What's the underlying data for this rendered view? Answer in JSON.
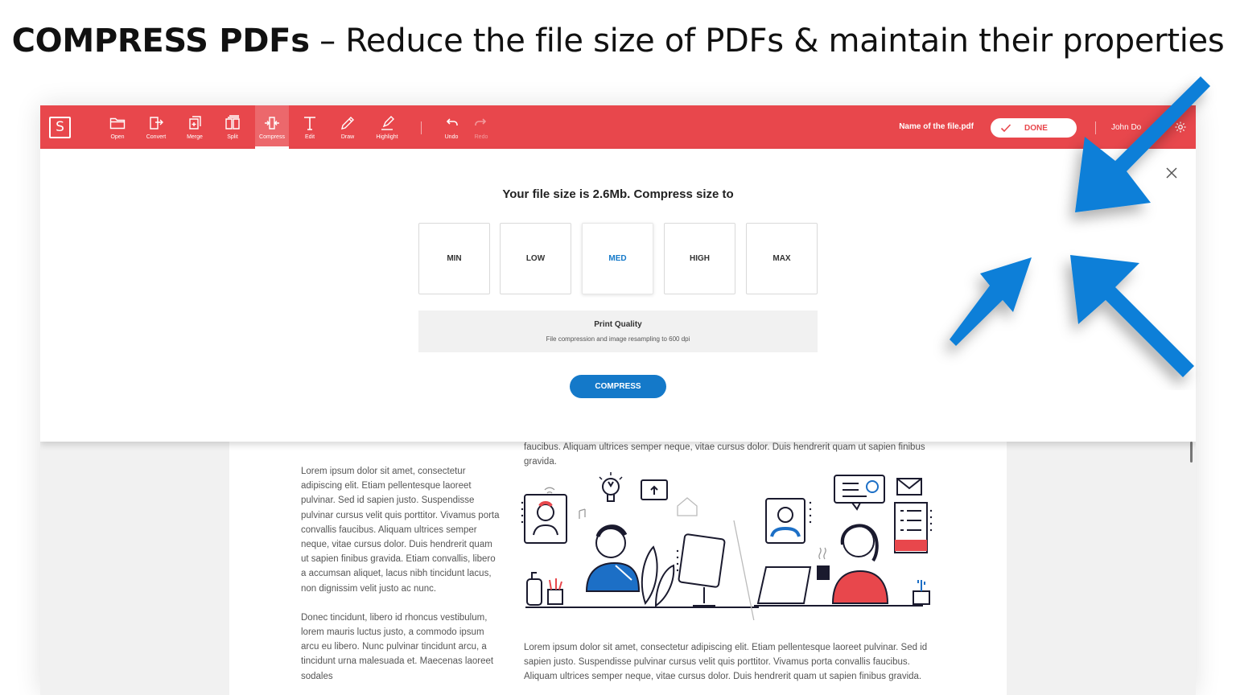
{
  "headline": {
    "bold": "COMPRESS PDFs",
    "rest": " – Reduce the file size of PDFs & maintain their properties"
  },
  "toolbar": {
    "logo": "S",
    "tools": [
      {
        "label": "Open",
        "icon": "folder-icon"
      },
      {
        "label": "Convert",
        "icon": "convert-icon"
      },
      {
        "label": "Merge",
        "icon": "merge-icon"
      },
      {
        "label": "Split",
        "icon": "split-icon"
      },
      {
        "label": "Compress",
        "icon": "compress-icon",
        "active": true
      },
      {
        "label": "Edit",
        "icon": "text-icon"
      },
      {
        "label": "Draw",
        "icon": "pencil-icon"
      },
      {
        "label": "Highlight",
        "icon": "highlighter-icon"
      },
      {
        "label": "Undo",
        "icon": "undo-icon"
      },
      {
        "label": "Redo",
        "icon": "redo-icon",
        "disabled": true
      }
    ],
    "filename": "Name of the file.pdf",
    "done_label": "DONE",
    "user": "John Do"
  },
  "compress": {
    "title": "Your file size is 2.6Mb. Compress size to",
    "options": [
      "MIN",
      "LOW",
      "MED",
      "HIGH",
      "MAX"
    ],
    "selected": "MED",
    "quality_title": "Print Quality",
    "quality_desc": "File compression and image resampling to 600 dpi",
    "button": "COMPRESS"
  },
  "document": {
    "col1_p1": "Lorem ipsum dolor sit amet, consectetur adipiscing elit. Etiam pellentesque laoreet pulvinar. Sed id sapien justo. Suspendisse pulvinar cursus velit quis porttitor. Vivamus porta convallis faucibus. Aliquam ultrices semper neque, vitae cursus dolor. Duis hendrerit quam ut sapien finibus gravida. Etiam convallis, libero a accumsan aliquet, lacus nibh tincidunt lacus, non dignissim velit justo ac nunc.",
    "col1_p2": "Donec tincidunt, libero id rhoncus vestibulum, lorem mauris luctus justo, a commodo ipsum arcu eu libero. Nunc pulvinar tincidunt arcu, a tincidunt urna malesuada et. Maecenas laoreet sodales",
    "col2_top": "faucibus. Aliquam ultrices semper neque, vitae cursus dolor. Duis hendrerit quam ut sapien finibus gravida.",
    "col2_bottom": "Lorem ipsum dolor sit amet, consectetur adipiscing elit. Etiam pellentesque laoreet pulvinar. Sed id sapien justo. Suspendisse pulvinar cursus velit quis porttitor. Vivamus porta convallis faucibus. Aliquam ultrices semper neque, vitae cursus dolor. Duis hendrerit quam ut sapien finibus gravida."
  },
  "colors": {
    "brand_red": "#e8474c",
    "accent_blue": "#1479c9",
    "arrow_blue": "#0a7fd8"
  }
}
